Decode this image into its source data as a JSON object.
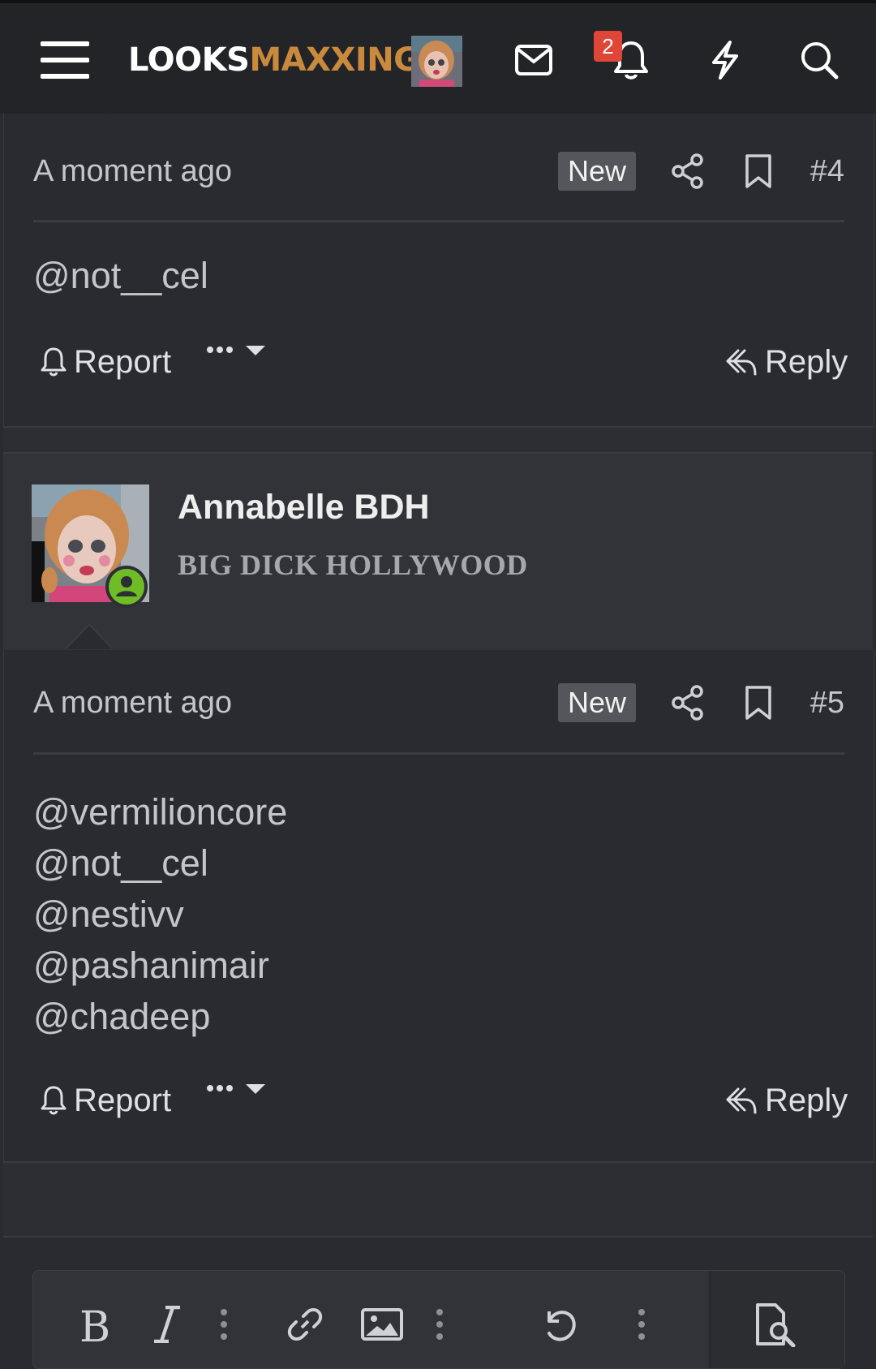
{
  "header": {
    "logo_part1": "LOOKS",
    "logo_part2": "MAXXING",
    "notification_count": "2",
    "colors": {
      "bar": "#232428",
      "accent": "#c98a3e",
      "badge": "#e04638"
    },
    "icons": [
      "menu-icon",
      "mail-icon",
      "bell-icon",
      "lightning-icon",
      "search-icon"
    ]
  },
  "posts": [
    {
      "time": "A moment ago",
      "new_label": "New",
      "number": "#4",
      "mentions": [
        "@not__cel"
      ],
      "report_label": "Report",
      "reply_label": "Reply"
    },
    {
      "author": "Annabelle BDH",
      "author_title": "BIG DICK HOLLYWOOD",
      "time": "A moment ago",
      "new_label": "New",
      "number": "#5",
      "mentions": [
        "@vermilioncore",
        "@not__cel",
        "@nestivv",
        "@pashanimair",
        "@chadeep"
      ],
      "report_label": "Report",
      "reply_label": "Reply"
    }
  ],
  "editor": {
    "tools": [
      "bold-icon",
      "italic-icon",
      "more-icon",
      "link-icon",
      "image-icon",
      "more-icon",
      "undo-icon",
      "more-icon",
      "preview-icon"
    ]
  }
}
